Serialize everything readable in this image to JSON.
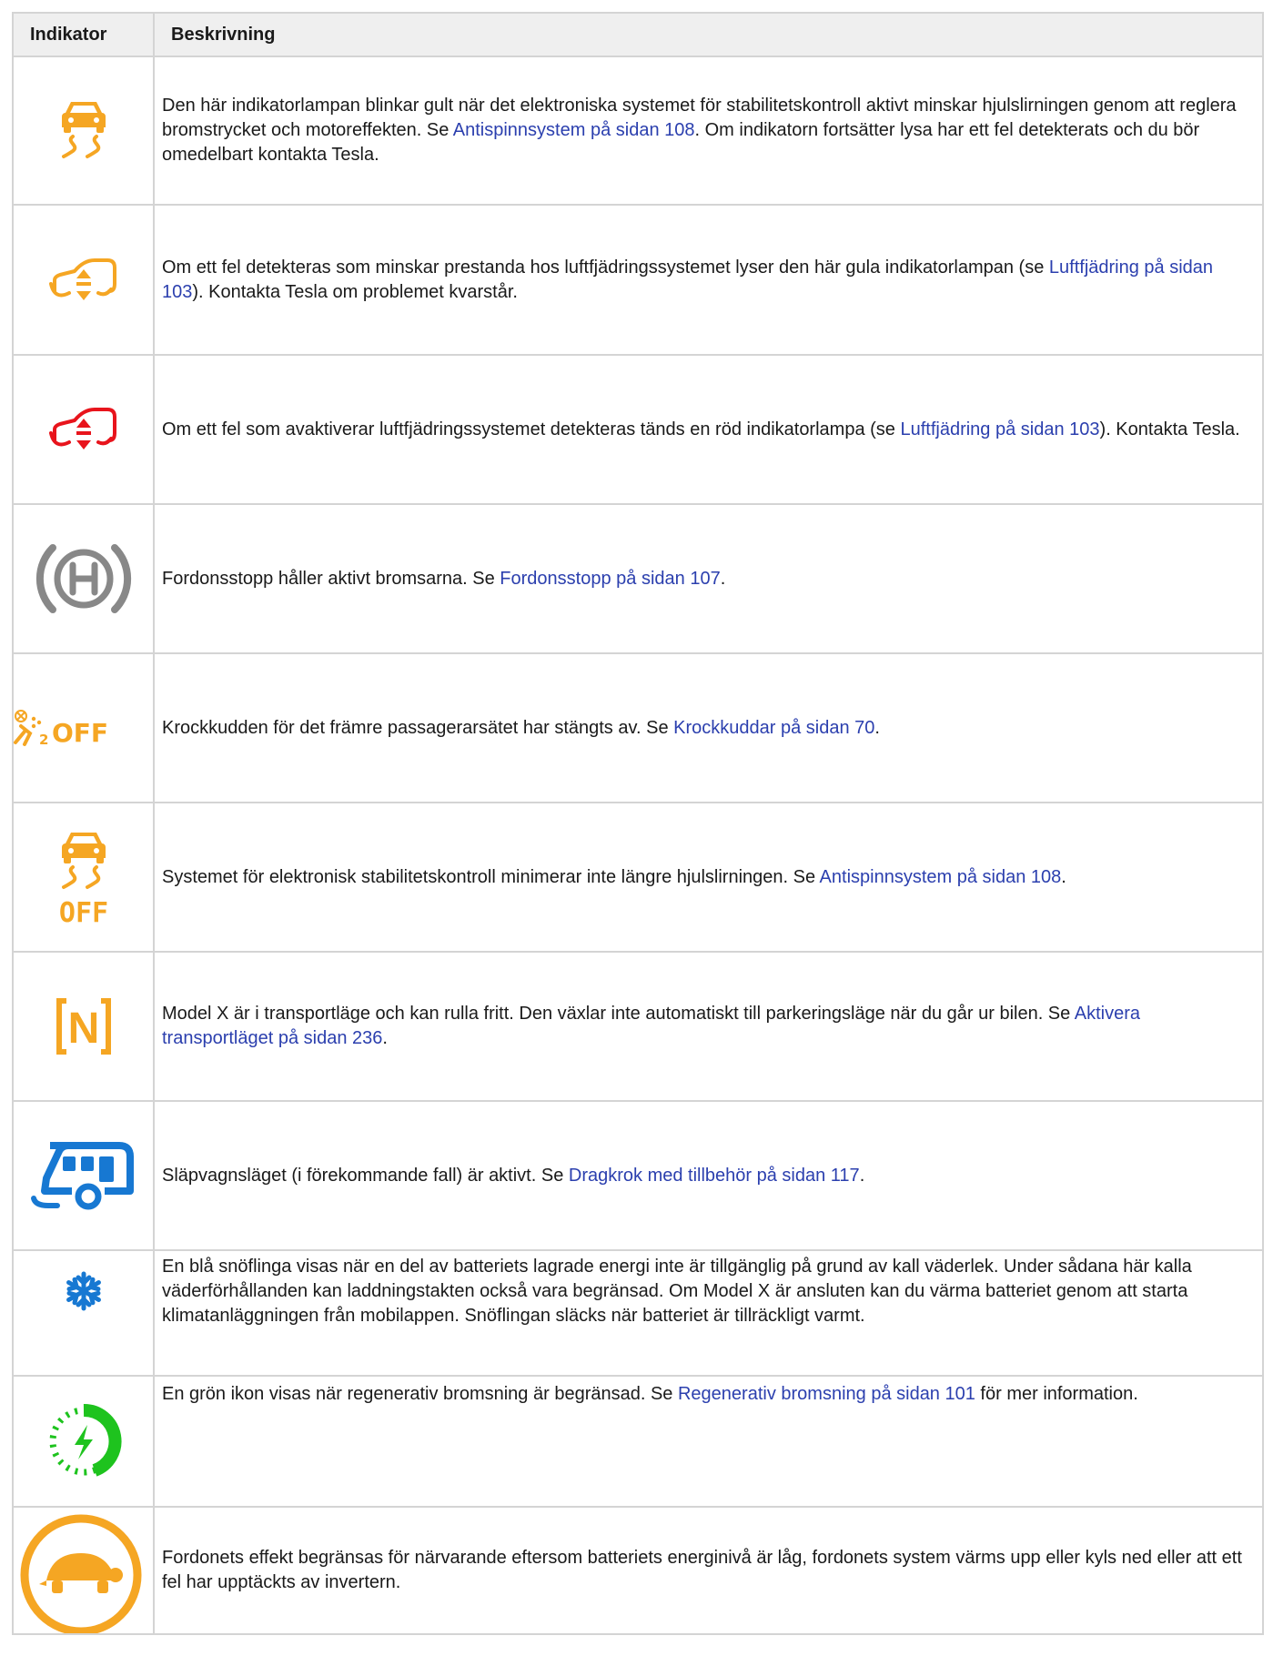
{
  "table": {
    "headers": {
      "indicator": "Indikator",
      "description": "Beskrivning"
    },
    "rows": [
      {
        "icon": "traction-control-icon",
        "text_before": "Den här indikatorlampan blinkar gult när det elektroniska systemet för stabilitetskontroll aktivt minskar hjulslirningen genom att reglera bromstrycket och motoreffekten. Se ",
        "link": "Antispinnsystem på sidan 108",
        "text_after": ". Om indikatorn fortsätter lysa har ett fel detekterats och du bör omedelbart kontakta Tesla."
      },
      {
        "icon": "air-suspension-warning-icon",
        "text_before": "Om ett fel detekteras som minskar prestanda hos luftfjädringssystemet lyser den här gula indikatorlampan (se ",
        "link": "Luftfjädring på sidan 103",
        "text_after": "). Kontakta Tesla om problemet kvarstår."
      },
      {
        "icon": "air-suspension-fault-icon",
        "text_before": "Om ett fel som avaktiverar luftfjädringssystemet detekteras tänds en röd indikatorlampa (se ",
        "link": "Luftfjädring på sidan 103",
        "text_after": "). Kontakta Tesla."
      },
      {
        "icon": "vehicle-hold-icon",
        "text_before": "Fordonsstopp håller aktivt bromsarna. Se ",
        "link": "Fordonsstopp på sidan 107",
        "text_after": "."
      },
      {
        "icon": "passenger-airbag-off-icon",
        "text_before": "Krockkudden för det främre passagerarsätet har stängts av. Se ",
        "link": "Krockkuddar på sidan 70",
        "text_after": "."
      },
      {
        "icon": "traction-control-off-icon",
        "text_before": "Systemet för elektronisk stabilitetskontroll minimerar inte längre hjulslirningen. Se ",
        "link": "Antispinnsystem på sidan 108",
        "text_after": "."
      },
      {
        "icon": "transport-mode-icon",
        "text_before": "Model X är i transportläge och kan rulla fritt. Den växlar inte automatiskt till parkeringsläge när du går ur bilen. Se ",
        "link": "Aktivera transportläget på sidan 236",
        "text_after": "."
      },
      {
        "icon": "trailer-mode-icon",
        "text_before": "Släpvagnsläget (i förekommande fall) är aktivt. Se ",
        "link": "Dragkrok med tillbehör på sidan 117",
        "text_after": "."
      },
      {
        "icon": "snowflake-icon",
        "text_before": "En blå snöflinga visas när en del av batteriets lagrade energi inte är tillgänglig på grund av kall väderlek. Under sådana här kalla väderförhållanden kan laddningstakten också vara begränsad. Om Model X är ansluten kan du värma batteriet genom att starta klimatanläggningen från mobilappen. Snöflingan släcks när batteriet är tillräckligt varmt.",
        "link": "",
        "text_after": ""
      },
      {
        "icon": "regen-limited-icon",
        "text_before": "En grön ikon visas när regenerativ bromsning är begränsad. Se ",
        "link": "Regenerativ bromsning på sidan 101",
        "text_after": " för mer information."
      },
      {
        "icon": "reduced-power-turtle-icon",
        "text_before": "Fordonets effekt begränsas för närvarande eftersom batteriets energinivå är låg, fordonets system värms upp eller kyls ned eller att ett fel har upptäckts av invertern.",
        "link": "",
        "text_after": ""
      }
    ]
  },
  "icon_labels": {
    "off": "OFF",
    "neutral": "N",
    "airbag_seat_number": "2"
  },
  "colors": {
    "amber": "#f5a623",
    "red": "#e8141c",
    "gray": "#888888",
    "blue": "#1778d2",
    "green": "#1ec31e",
    "link": "#2b3fae",
    "header_bg": "#efefef",
    "border": "#d4d4d4"
  }
}
